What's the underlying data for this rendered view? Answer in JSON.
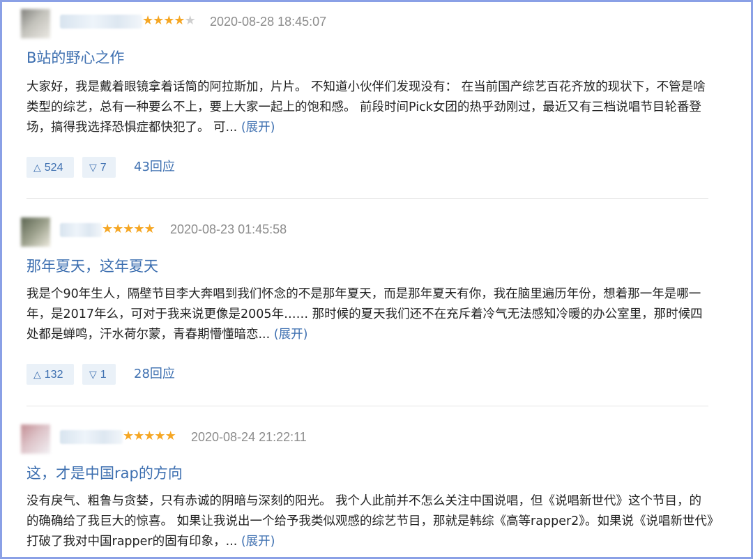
{
  "reviews": [
    {
      "stars_filled": 4,
      "stars_total": 5,
      "rating_stars": "★★★★★",
      "time": "2020-08-28 18:45:07",
      "title": "B站的野心之作",
      "body": "大家好，我是戴着眼镜拿着话筒的阿拉斯加，片片。 不知道小伙伴们发现没有： 在当前国产综艺百花齐放的现状下，不管是啥类型的综艺，总有一种要么不上，要上大家一起上的饱和感。 前段时间Pick女团的热乎劲刚过，最近又有三档说唱节目轮番登场，搞得我选择恐惧症都快犯了。 可... ",
      "expand": "(展开)",
      "useful": "524",
      "useless": "7",
      "replies": "43回应"
    },
    {
      "stars_filled": 5,
      "stars_total": 5,
      "rating_stars": "★★★★★",
      "time": "2020-08-23 01:45:58",
      "title": "那年夏天，这年夏天",
      "body": "我是个90年生人，隔壁节目李大奔唱到我们怀念的不是那年夏天，而是那年夏天有你，我在脑里遍历年份，想着那一年是哪一年，是2017年么，可对于我来说更像是2005年…… 那时候的夏天我们还不在充斥着冷气无法感知冷暖的办公室里，那时候四处都是蝉鸣，汗水荷尔蒙，青春期懵懂暗恋... ",
      "expand": "(展开)",
      "useful": "132",
      "useless": "1",
      "replies": "28回应"
    },
    {
      "stars_filled": 5,
      "stars_total": 5,
      "rating_stars": "★★★★★",
      "time": "2020-08-24 21:22:11",
      "title": "这，才是中国rap的方向",
      "body": "没有戾气、粗鲁与贪婪，只有赤诚的阴暗与深刻的阳光。 我个人此前并不怎么关注中国说唱，但《说唱新世代》这个节目，的的确确给了我巨大的惊喜。 如果让我说出一个给予我类似观感的综艺节目，那就是韩综《高等rapper2》。如果说《说唱新世代》打破了我对中国rapper的固有印象，... ",
      "expand": "(展开)"
    }
  ],
  "icons": {
    "up": "up-triangle-icon",
    "down": "down-triangle-icon",
    "star": "star-icon"
  },
  "colors": {
    "link": "#3d6fb0",
    "star_on": "#f5a623",
    "vote_bg": "#eaf1f8",
    "border": "#8aa0e6"
  }
}
